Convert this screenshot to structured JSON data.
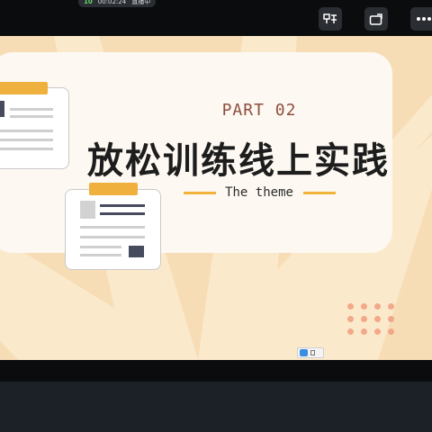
{
  "status": {
    "signal": "10",
    "elapsed_time": "00:02:24",
    "status_text": "直播中"
  },
  "toolbar": {
    "icons": [
      "caption-icon",
      "share-screen-icon",
      "more-icon"
    ]
  },
  "slide": {
    "part_label": "PART 02",
    "title": "放松训练线上实践",
    "subtitle": "The theme"
  },
  "colors": {
    "slide_background": "#f7ddb6",
    "card": "#fdf8f2",
    "accent_yellow": "#efb03e",
    "part_label": "#8e4f3c",
    "dots": "#f2a98a"
  }
}
